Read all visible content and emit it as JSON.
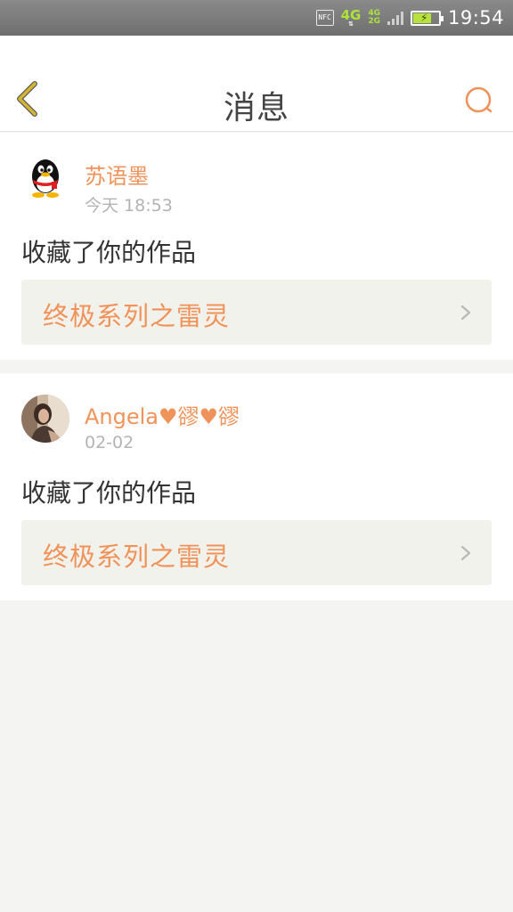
{
  "status_bar": {
    "nfc": "NFC",
    "network_primary": "4G",
    "network_secondary_top": "4G",
    "network_secondary_bottom": "2G",
    "time": "19:54"
  },
  "header": {
    "title": "消息",
    "back_icon": "chevron-left-icon",
    "search_icon": "search-icon"
  },
  "messages": [
    {
      "user": "苏语墨",
      "time": "今天 18:53",
      "action": "收藏了你的作品",
      "work_title": "终极系列之雷灵",
      "avatar": "qq-penguin-avatar"
    },
    {
      "user": "Angela♥豂♥豂",
      "time": "02-02",
      "action": "收藏了你的作品",
      "work_title": "终极系列之雷灵",
      "avatar": "photo-avatar"
    }
  ],
  "colors": {
    "accent": "#f0935a",
    "back_icon": "#c9a227",
    "card_link_bg": "#f2f2ec",
    "page_bg": "#f4f4f2"
  }
}
